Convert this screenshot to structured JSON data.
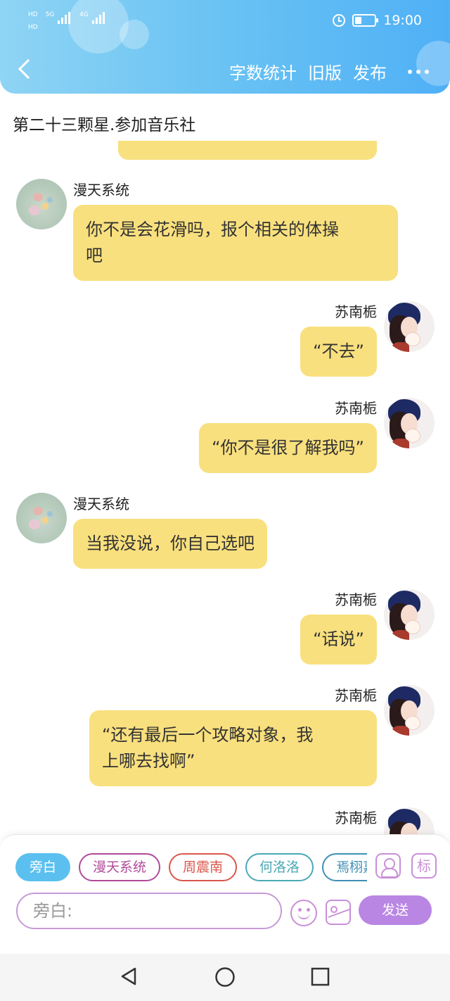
{
  "status_bar": {
    "left_labels": [
      "HD",
      "5G",
      "HD",
      "4G"
    ],
    "time": "19:00"
  },
  "header": {
    "actions": [
      "字数统计",
      "旧版",
      "发布"
    ],
    "icons": [
      "back-icon",
      "more-icon",
      "alarm-icon",
      "battery-icon"
    ]
  },
  "chapter_title": "第二十三颗星.参加音乐社",
  "messages": [
    {
      "side": "left",
      "name": "漫天系统",
      "lines": [
        "你不是会花滑吗，报个相关的体操",
        "吧"
      ]
    },
    {
      "side": "right",
      "name": "苏南栀",
      "lines": [
        "“不去”"
      ]
    },
    {
      "side": "right",
      "name": "苏南栀",
      "lines": [
        "“你不是很了解我吗”"
      ]
    },
    {
      "side": "left",
      "name": "漫天系统",
      "lines": [
        "当我没说，你自己选吧"
      ]
    },
    {
      "side": "right",
      "name": "苏南栀",
      "lines": [
        "“话说”"
      ]
    },
    {
      "side": "right",
      "name": "苏南栀",
      "lines": [
        "“还有最后一个攻略对象，我",
        "上哪去找啊”"
      ]
    },
    {
      "side": "right",
      "name": "苏南栀",
      "lines": []
    }
  ],
  "input_panel": {
    "chips": [
      {
        "label": "旁白",
        "color": "#5bc0ef",
        "filled": true
      },
      {
        "label": "漫天系统",
        "color": "#b04a9a",
        "filled": false
      },
      {
        "label": "周震南",
        "color": "#d9574a",
        "filled": false
      },
      {
        "label": "何洛洛",
        "color": "#4aa9b5",
        "filled": false
      },
      {
        "label": "焉栩嘉",
        "color": "#3f8fb5",
        "filled": false
      }
    ],
    "tool_label": "标",
    "placeholder": "旁白:",
    "send_label": "发送"
  },
  "colors": {
    "bubble": "#f9e07e",
    "header_gradient": [
      "#8fd4f4",
      "#4fb0f6"
    ],
    "send_button": "#b986e3",
    "icon_purple": "#c98fd8"
  }
}
